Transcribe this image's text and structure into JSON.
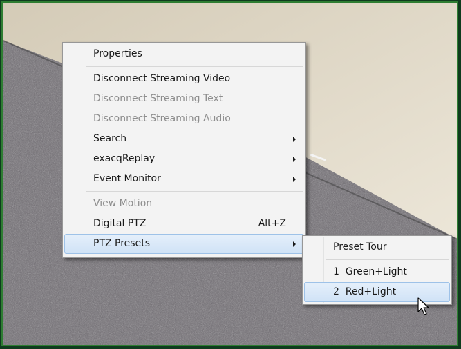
{
  "context_menu": {
    "items": [
      {
        "label": "Properties"
      },
      {
        "label": "Disconnect Streaming Video"
      },
      {
        "label": "Disconnect Streaming Text"
      },
      {
        "label": "Disconnect Streaming Audio"
      },
      {
        "label": "Search"
      },
      {
        "label": "exacqReplay"
      },
      {
        "label": "Event Monitor"
      },
      {
        "label": "View Motion"
      },
      {
        "label": "Digital PTZ",
        "shortcut": "Alt+Z"
      },
      {
        "label": "PTZ Presets"
      }
    ]
  },
  "submenu": {
    "items": [
      {
        "label": "Preset Tour"
      },
      {
        "label": "1  Green+Light"
      },
      {
        "label": "2  Red+Light"
      }
    ]
  },
  "colors": {
    "frame_border": "#2e7d32",
    "highlight": "#cfe2f6",
    "disabled_text": "#8d8d8d",
    "wall": "#ded6c4",
    "carpet": "#6f6b71"
  }
}
